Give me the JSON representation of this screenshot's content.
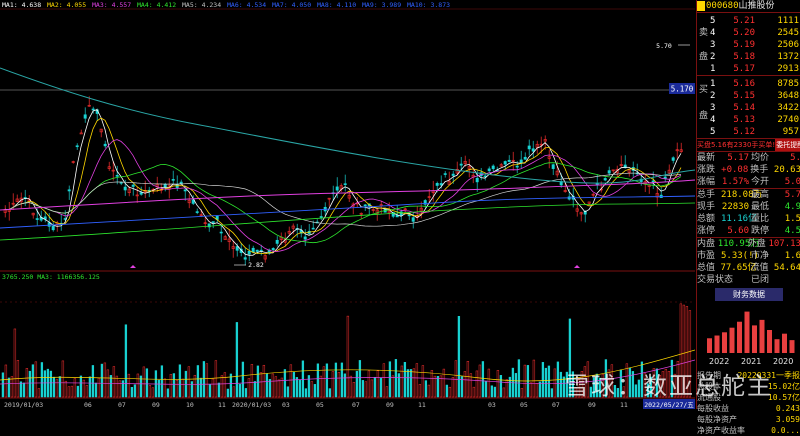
{
  "ma_bar": {
    "items": [
      {
        "label": "MA1: 4.638",
        "color": "#ffffff"
      },
      {
        "label": "MA2: 4.055",
        "color": "#ffd800"
      },
      {
        "label": "MA3: 4.557",
        "color": "#e040e0"
      },
      {
        "label": "MA4: 4.412",
        "color": "#2ee62e"
      },
      {
        "label": "MA5: 4.234",
        "color": "#c0c0c0"
      },
      {
        "label": "MA6: 4.534",
        "color": "#3060ff"
      },
      {
        "label": "MA7: 4.050",
        "color": "#3060ff"
      },
      {
        "label": "MA8: 4.110",
        "color": "#3060ff"
      },
      {
        "label": "MA9: 3.989",
        "color": "#3060ff"
      },
      {
        "label": "MA10: 3.873",
        "color": "#3060ff"
      }
    ]
  },
  "price_chart": {
    "high_label": "5.70",
    "low_label": "2.82",
    "current_price_tag": "5.170"
  },
  "volume_bar": {
    "text": "3765.250 MA3: 1166356.125"
  },
  "x_axis": {
    "labels": [
      "2019/01/03",
      "06",
      "07",
      "09",
      "10",
      "11",
      "2020/01/03",
      "03",
      "05",
      "07",
      "09",
      "11",
      "2021/01/03",
      "03",
      "05",
      "07",
      "09",
      "11",
      "2022/01/03",
      "03",
      "2022/05/27/五"
    ]
  },
  "stock": {
    "code": "000680",
    "name": "山推股份"
  },
  "order_book": {
    "sell_label_top": "卖",
    "sell_label_bottom": "盘",
    "buy_label_top": "买",
    "buy_label_bottom": "盘",
    "sells": [
      {
        "level": "5",
        "price": "5.21",
        "vol": "1111"
      },
      {
        "level": "4",
        "price": "5.20",
        "vol": "2545"
      },
      {
        "level": "3",
        "price": "5.19",
        "vol": "2506"
      },
      {
        "level": "2",
        "price": "5.18",
        "vol": "1372"
      },
      {
        "level": "1",
        "price": "5.17",
        "vol": "2913"
      }
    ],
    "buys": [
      {
        "level": "1",
        "price": "5.16",
        "vol": "8785"
      },
      {
        "level": "2",
        "price": "5.15",
        "vol": "3648"
      },
      {
        "level": "3",
        "price": "5.14",
        "vol": "3422"
      },
      {
        "level": "4",
        "price": "5.13",
        "vol": "2740"
      },
      {
        "level": "5",
        "price": "5.12",
        "vol": "957"
      }
    ]
  },
  "notice": {
    "text": "买盘5.16有2330手买单!",
    "button": "委托提醒"
  },
  "stats": [
    {
      "l1": "最新",
      "v1": "5.17",
      "c1": "red",
      "l2": "均价",
      "v2": "5.",
      "c2": "red"
    },
    {
      "l1": "涨跌",
      "v1": "+0.08",
      "c1": "red",
      "l2": "换手",
      "v2": "20.63",
      "c2": "yellow"
    },
    {
      "l1": "涨幅",
      "v1": "1.57%",
      "c1": "red",
      "l2": "今开",
      "v2": "5.0",
      "c2": "red"
    },
    {
      "l1": "总手",
      "v1": "218.08万",
      "c1": "yellow",
      "l2": "最高",
      "v2": "5.7",
      "c2": "red"
    },
    {
      "l1": "现手",
      "v1": "22830",
      "c1": "yellow",
      "l2": "最低",
      "v2": "4.9",
      "c2": "green"
    },
    {
      "l1": "总额",
      "v1": "11.16亿",
      "c1": "cyan",
      "l2": "量比",
      "v2": "1.5",
      "c2": "yellow"
    },
    {
      "l1": "涨停",
      "v1": "5.60",
      "c1": "red",
      "l2": "跌停",
      "v2": "4.5",
      "c2": "green"
    },
    {
      "l1": "内盘",
      "v1": "110.95万",
      "c1": "green",
      "l2": "外盘",
      "v2": "107.13",
      "c2": "red"
    },
    {
      "l1": "市盈",
      "v1": "5.33(!)",
      "c1": "yellow",
      "l2": "市净",
      "v2": "1.6",
      "c2": "yellow"
    },
    {
      "l1": "总值",
      "v1": "77.65亿",
      "c1": "yellow",
      "l2": "流值",
      "v2": "54.64",
      "c2": "yellow"
    },
    {
      "l1": "交易状态",
      "v1": "",
      "c1": "white",
      "l2": "已闭",
      "v2": "",
      "c2": "white"
    }
  ],
  "finance": {
    "tab_label": "财务数据",
    "years": [
      "2022",
      "2021",
      "2020"
    ],
    "bar_values_pct": [
      0.32,
      0.38,
      0.45,
      0.55,
      0.68,
      0.9,
      0.6,
      0.72,
      0.5,
      0.3,
      0.42,
      0.28
    ],
    "rows": [
      {
        "label": "报告期",
        "value": "20220331一季报"
      },
      {
        "label": "总股本",
        "value": "15.02亿"
      },
      {
        "label": "流通股",
        "value": "10.57亿"
      },
      {
        "label": "每股收益",
        "value": "0.243"
      },
      {
        "label": "每股净资产",
        "value": "3.059"
      },
      {
        "label": "净资产收益率",
        "value": "0.0..."
      }
    ]
  },
  "watermark": "雪球：数亚总舵主",
  "colors": {
    "up": "#ff3030",
    "down": "#2ee62e",
    "ma_white": "#ffffff",
    "ma_yellow": "#ffd800",
    "ma_magenta": "#e040e0",
    "ma_green": "#2ee62e",
    "ma_teal": "#2aa6a6",
    "grid": "#7a1010"
  }
}
